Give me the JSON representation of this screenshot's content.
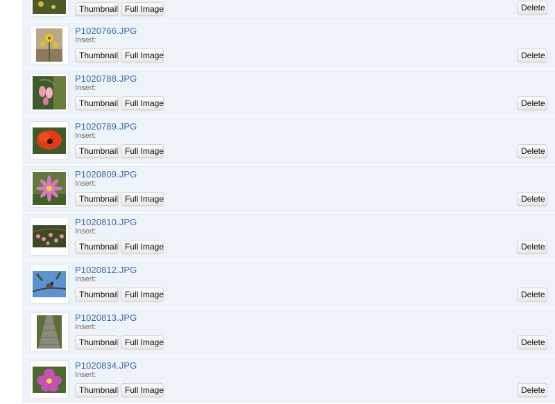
{
  "labels": {
    "insert": "Insert:",
    "thumbnail_button": "Thumbnail",
    "full_image_button": "Full Image",
    "delete_button": "Delete"
  },
  "images": [
    {
      "filename": "",
      "thumb_icon": "yellow-flowers-photo-icon"
    },
    {
      "filename": "P1020766.JPG",
      "thumb_icon": "yellow-flower-photo-icon"
    },
    {
      "filename": "P1020788.JPG",
      "thumb_icon": "pink-bell-flowers-photo-icon"
    },
    {
      "filename": "P1020789.JPG",
      "thumb_icon": "red-poppy-photo-icon"
    },
    {
      "filename": "P1020809.JPG",
      "thumb_icon": "pink-daisy-photo-icon"
    },
    {
      "filename": "P1020810.JPG",
      "thumb_icon": "pink-blossoms-photo-icon"
    },
    {
      "filename": "P1020812.JPG",
      "thumb_icon": "bird-on-branch-photo-icon"
    },
    {
      "filename": "P1020813.JPG",
      "thumb_icon": "wooden-path-photo-icon"
    },
    {
      "filename": "P1020834.JPG",
      "thumb_icon": "purple-flower-photo-icon"
    }
  ]
}
